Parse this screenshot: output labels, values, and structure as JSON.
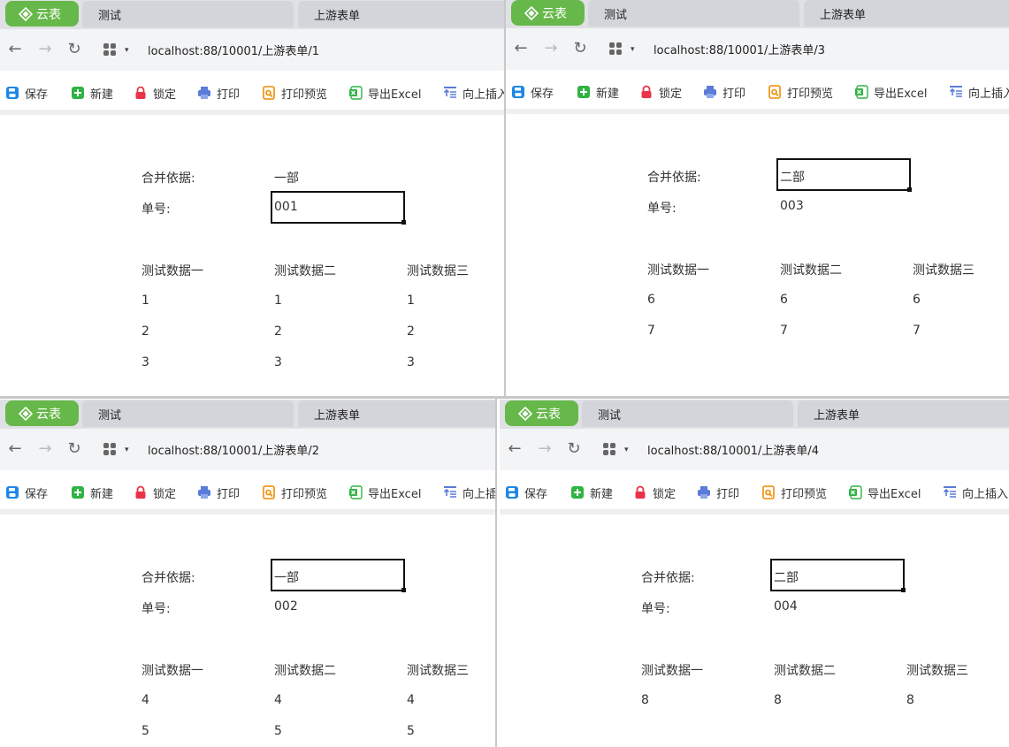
{
  "brand_label": "云表",
  "colors": {
    "brand": "#67b84a",
    "save": "#1e88e5",
    "new": "#2fb344",
    "lock": "#e8334a",
    "print": "#5a7bd8",
    "preview": "#f08c00",
    "excel": "#2fb344",
    "insert": "#5a7bd8"
  },
  "windows": [
    {
      "tabs": [
        "测试",
        "上游表单"
      ],
      "url": "localhost:88/10001/上游表单/1",
      "toolbar": [
        "保存",
        "新建",
        "锁定",
        "打印",
        "打印预览",
        "导出Excel",
        "向上插入"
      ],
      "form": {
        "merge_label": "合并依据:",
        "merge_value": "一部",
        "no_label": "单号:",
        "no_value": "001"
      },
      "table": {
        "headers": [
          "测试数据一",
          "测试数据二",
          "测试数据三"
        ],
        "rows": [
          [
            "1",
            "1",
            "1"
          ],
          [
            "2",
            "2",
            "2"
          ],
          [
            "3",
            "3",
            "3"
          ]
        ]
      }
    },
    {
      "tabs": [
        "测试",
        "上游表单"
      ],
      "url": "localhost:88/10001/上游表单/3",
      "toolbar": [
        "保存",
        "新建",
        "锁定",
        "打印",
        "打印预览",
        "导出Excel",
        "向上插入"
      ],
      "form": {
        "merge_label": "合并依据:",
        "merge_value": "二部",
        "no_label": "单号:",
        "no_value": "003"
      },
      "table": {
        "headers": [
          "测试数据一",
          "测试数据二",
          "测试数据三"
        ],
        "rows": [
          [
            "6",
            "6",
            "6"
          ],
          [
            "7",
            "7",
            "7"
          ]
        ]
      }
    },
    {
      "tabs": [
        "测试",
        "上游表单"
      ],
      "url": "localhost:88/10001/上游表单/2",
      "toolbar": [
        "保存",
        "新建",
        "锁定",
        "打印",
        "打印预览",
        "导出Excel",
        "向上插入"
      ],
      "form": {
        "merge_label": "合并依据:",
        "merge_value": "一部",
        "no_label": "单号:",
        "no_value": "002"
      },
      "table": {
        "headers": [
          "测试数据一",
          "测试数据二",
          "测试数据三"
        ],
        "rows": [
          [
            "4",
            "4",
            "4"
          ],
          [
            "5",
            "5",
            "5"
          ]
        ]
      }
    },
    {
      "tabs": [
        "测试",
        "上游表单"
      ],
      "url": "localhost:88/10001/上游表单/4",
      "toolbar": [
        "保存",
        "新建",
        "锁定",
        "打印",
        "打印预览",
        "导出Excel",
        "向上插入"
      ],
      "form": {
        "merge_label": "合并依据:",
        "merge_value": "二部",
        "no_label": "单号:",
        "no_value": "004"
      },
      "table": {
        "headers": [
          "测试数据一",
          "测试数据二",
          "测试数据三"
        ],
        "rows": [
          [
            "8",
            "8",
            "8"
          ]
        ]
      }
    }
  ]
}
